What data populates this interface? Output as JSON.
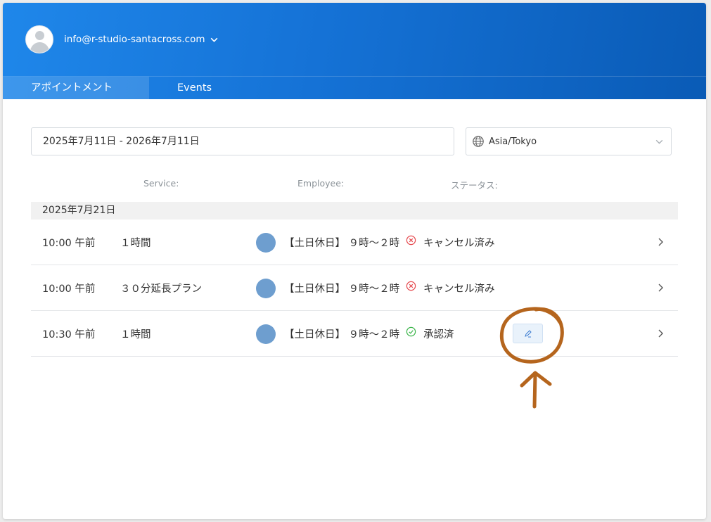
{
  "header": {
    "user_email": "info@r-studio-santacross.com",
    "tabs": [
      {
        "label": "アポイントメント",
        "active": true
      },
      {
        "label": "Events",
        "active": false
      }
    ]
  },
  "filters": {
    "date_range": "2025年7月11日 - 2026年7月11日",
    "timezone": "Asia/Tokyo"
  },
  "columns": {
    "service": "Service:",
    "employee": "Employee:",
    "status": "ステータス:"
  },
  "group": {
    "date": "2025年7月21日",
    "rows": [
      {
        "time": "10:00 午前",
        "service": "１時間",
        "employee": "【土日休日】 ９時〜２時",
        "status": "キャンセル済み",
        "status_type": "cancelled"
      },
      {
        "time": "10:00 午前",
        "service": "３０分延長プラン",
        "employee": "【土日休日】 ９時〜２時",
        "status": "キャンセル済み",
        "status_type": "cancelled"
      },
      {
        "time": "10:30 午前",
        "service": "１時間",
        "employee": "【土日休日】 ９時〜２時",
        "status": "承認済",
        "status_type": "approved"
      }
    ]
  },
  "colors": {
    "header_start": "#1f87ea",
    "header_end": "#0a5bb6",
    "cancelled": "#e5484d",
    "approved": "#3bb54a",
    "annotation": "#b5651d",
    "employee_avatar": "#6e9ecf"
  },
  "icons": {
    "user_menu": "chevron-down-icon",
    "timezone": "globe-icon",
    "cancelled": "x-circle-icon",
    "approved": "check-circle-icon",
    "edit": "pencil-icon",
    "row_open": "chevron-right-icon"
  }
}
